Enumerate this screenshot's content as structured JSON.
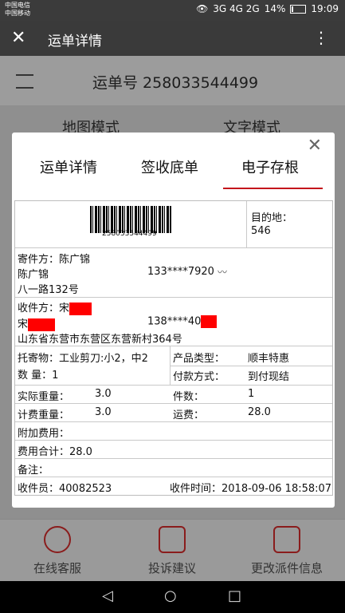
{
  "status": {
    "carrier1": "中国电信",
    "carrier2": "中国移动",
    "net": "3G 4G 2G",
    "battery": "14%",
    "time": "19:09"
  },
  "titlebar": {
    "title": "运单详情"
  },
  "header": {
    "waybill_label": "运单号 258033544499"
  },
  "modes": {
    "map": "地图模式",
    "text": "文字模式"
  },
  "modal": {
    "tabs": [
      "运单详情",
      "签收底单",
      "电子存根"
    ],
    "barcode_number": "258033544499",
    "destination_label": "目的地：",
    "destination_code": "546",
    "sender_label": "寄件方：陈广锦",
    "sender_name": "陈广锦",
    "sender_phone": "133****7920",
    "sender_address": "八一路132号",
    "receiver_label": "收件方：宋",
    "receiver_name": "宋",
    "receiver_phone": "138****40",
    "receiver_address": "山东省东营市东营区东营新村364号",
    "goods_label": "托寄物：工业剪刀:小2，中2",
    "qty_label": "数  量：1",
    "product_type_label": "产品类型：",
    "product_type_value": "顺丰特惠",
    "payment_label": "付款方式：",
    "payment_value": "到付现结",
    "actual_weight_label": "实际重量：",
    "actual_weight_value": "3.0",
    "pieces_label": "件数：",
    "pieces_value": "1",
    "charge_weight_label": "计费重量：",
    "charge_weight_value": "3.0",
    "freight_label": "运费：",
    "freight_value": "28.0",
    "extra_fee_label": "附加费用：",
    "total_fee_label": "费用合计：28.0",
    "remark_label": "备注：",
    "collector_label": "收件员：40082523",
    "collect_time_label": "收件时间：2018-09-06 18:58:07"
  },
  "bottom": {
    "service": "在线客服",
    "complaint": "投诉建议",
    "modify": "更改派件信息"
  }
}
